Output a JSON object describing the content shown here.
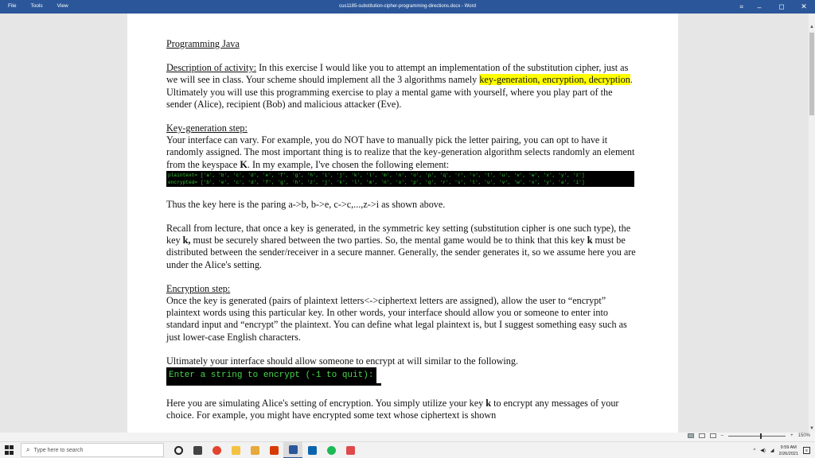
{
  "window": {
    "title": "cus1185-substitution-cipher-programming-directions.docx  -  Word",
    "menu": [
      "File",
      "Tools",
      "View"
    ],
    "controls": {
      "minimize": "–",
      "maximize": "◻",
      "close": "✕"
    },
    "accent": "#2b579a"
  },
  "document": {
    "heading": "Programming Java",
    "desc_label": "Description of activity:",
    "desc_text1": " In this exercise I would like you to attempt an implementation of the substitution cipher, just as we will see in class.  Your scheme should implement all the 3 algorithms namely ",
    "desc_highlight": "key-generation, encryption, decryption",
    "desc_text2": ".  Ultimately you will use this programming exercise to play a mental game with yourself, where you play part of the sender (Alice), recipient (Bob) and malicious attacker (Eve).",
    "keygen_label": "Key-generation step:",
    "keygen_text1": "Your interface can vary.  For example, you do NOT have to manually pick the letter pairing, you can opt to have it randomly assigned.  The most important thing is to realize that the key-generation algorithm selects randomly an element from the keyspace ",
    "keygen_K": "K",
    "keygen_text2": ".  In my example, I've chosen the following element:",
    "code_plaintext": "plaintext= ['a', 'b', 'c', 'd', 'e', 'f', 'g', 'h', 'i', 'j', 'k', 'l', 'm', 'n', 'o', 'p', 'q', 'r', 's', 't', 'u', 'v', 'w', 'x', 'y', 'z']",
    "code_encrypted": "encrypted= ['b', 'e', 'c', 'd', 'f', 'g', 'h', 'z', 'j', 'k', 'l', 'm', 'n', 'o', 'p', 'q', 'r', 's', 't', 'u', 'v', 'w', 'x', 'y', 'a', 'i']",
    "key_para": "Thus the key here is the paring a->b, b->e, c->c,...,z->i as shown above.",
    "recall_text1": "Recall from lecture, that once a key is generated, in the symmetric key setting (substitution cipher is one such type), the key ",
    "recall_k1": "k,",
    "recall_text2": " must be securely shared between the two parties.  So, the mental game would be to think that this key ",
    "recall_k2": "k",
    "recall_text3": " must be distributed between the sender/receiver in a secure manner.  Generally, the sender generates it, so we assume here you are under the Alice's setting.",
    "enc_label": "Encryption step:",
    "enc_text": "Once the key is generated (pairs of plaintext letters<->ciphertext letters are assigned), allow the user to “encrypt” plaintext words using this particular key.  In other words, your interface should allow you or someone to enter into standard input and “encrypt” the plaintext.  You can define what legal plaintext is, but I suggest something easy such as just lower-case English characters.",
    "ult_text": "Ultimately your interface should allow someone to encrypt at will similar to the following.",
    "console_text": "Enter a string to encrypt (-1 to quit):",
    "alice_text1": "Here you are simulating Alice's setting of encryption.  You simply utilize your key ",
    "alice_k": "k",
    "alice_text2": " to encrypt any messages of your choice.  For example, you might have encrypted some text whose ciphertext is shown"
  },
  "statusbar": {
    "zoom": "150%",
    "zoom_minus": "–",
    "zoom_plus": "+"
  },
  "taskbar": {
    "search_placeholder": "Type here to search",
    "time": "9:59 AM",
    "date": "2/26/2021",
    "apps": [
      {
        "name": "cortana",
        "color": "#222222"
      },
      {
        "name": "task-view",
        "color": "#444444"
      },
      {
        "name": "chrome",
        "color": "#e4432d"
      },
      {
        "name": "file-explorer",
        "color": "#f4c242"
      },
      {
        "name": "store",
        "color": "#e7a93a"
      },
      {
        "name": "office",
        "color": "#d83b01"
      },
      {
        "name": "word",
        "color": "#2b579a"
      },
      {
        "name": "mail",
        "color": "#0a64ad"
      },
      {
        "name": "spotify",
        "color": "#1db954"
      },
      {
        "name": "app",
        "color": "#e04a4a"
      }
    ]
  }
}
